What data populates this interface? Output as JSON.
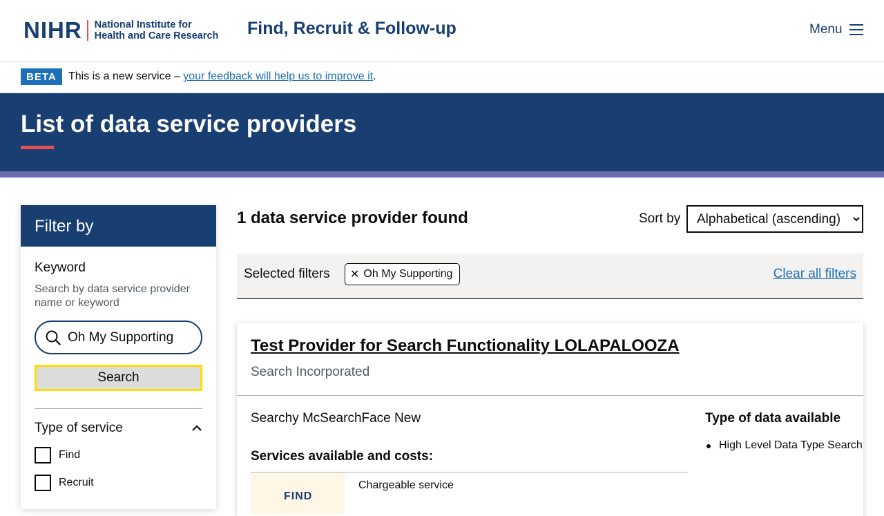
{
  "header": {
    "logo_mark": "NIHR",
    "logo_text_line1": "National Institute for",
    "logo_text_line2": "Health and Care Research",
    "service_name": "Find, Recruit & Follow-up",
    "menu_label": "Menu",
    "menu_icon": "hamburger-icon"
  },
  "beta": {
    "tag": "BETA",
    "text_before": "This is a new service – ",
    "link_text": "your feedback will help us to improve it",
    "text_after": "."
  },
  "hero": {
    "title": "List of data service providers"
  },
  "filter": {
    "heading": "Filter by",
    "keyword_label": "Keyword",
    "keyword_hint": "Search by data service provider name or keyword",
    "keyword_value": "Oh My Supporting",
    "search_icon": "search-icon",
    "search_button": "Search",
    "type_of_service_label": "Type of service",
    "type_of_service_icon": "chevron-up-icon",
    "options": [
      {
        "label": "Find",
        "checked": false
      },
      {
        "label": "Recruit",
        "checked": false
      }
    ]
  },
  "results": {
    "count_text": "1 data service provider found",
    "sort_label": "Sort by",
    "sort_selected": "Alphabetical (ascending)",
    "selected_filters_label": "Selected filters",
    "chip_label": "Oh My Supporting",
    "clear_all": "Clear all filters",
    "card": {
      "title": "Test Provider for Search Functionality LOLAPALOOZA",
      "organisation": "Search Incorporated",
      "description": "Searchy McSearchFace New",
      "services_title": "Services available and costs:",
      "service_tag": "FIND",
      "service_cost": "Chargeable service",
      "types_title": "Type of data available",
      "types": [
        "High Level Data Type Search"
      ]
    }
  },
  "colors": {
    "brand_navy": "#193e72",
    "accent_red": "#e84e4f",
    "stripe_purple": "#6c6bad",
    "link_blue": "#1d70b8",
    "focus_yellow": "#ffdd00"
  }
}
